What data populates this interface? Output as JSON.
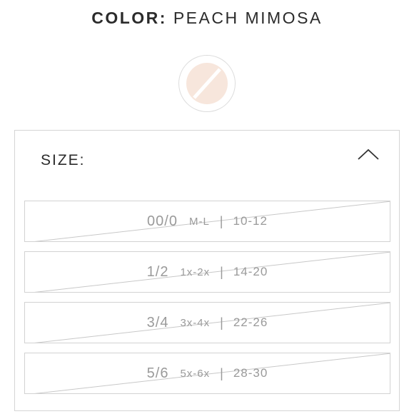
{
  "color": {
    "label": "COLOR:",
    "value": "PEACH MIMOSA",
    "swatch_color": "#f7e6dc",
    "swatch_unavailable": true
  },
  "size": {
    "title": "SIZE:",
    "toggle_icon": "chevron-up-icon",
    "options": [
      {
        "size": "00/0",
        "alt": "M-L",
        "range": "10-12",
        "unavailable": true
      },
      {
        "size": "1/2",
        "alt": "1x-2x",
        "range": "14-20",
        "unavailable": true
      },
      {
        "size": "3/4",
        "alt": "3x-4x",
        "range": "22-26",
        "unavailable": true
      },
      {
        "size": "5/6",
        "alt": "5x-6x",
        "range": "28-30",
        "unavailable": true
      }
    ],
    "separator": "|"
  },
  "colors": {
    "text_dark": "#2b2b2b",
    "text_disabled": "#9a9a9a",
    "border": "#d4d4d4",
    "strike": "#c8c8c8"
  }
}
